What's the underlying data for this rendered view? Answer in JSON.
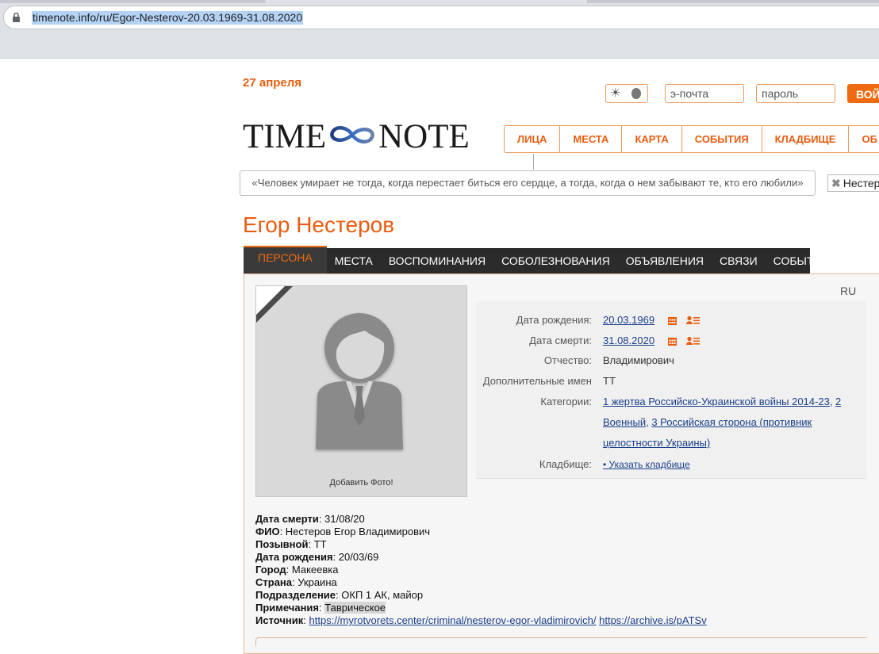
{
  "browser": {
    "url": "timenote.info/ru/Egor-Nesterov-20.03.1969-31.08.2020"
  },
  "header": {
    "date": "27 апреля",
    "email_placeholder": "э-почта",
    "password_placeholder": "пароль",
    "login_label": "ВОЙ",
    "logo_left": "TIME",
    "logo_right": "NOTE",
    "nav": [
      "ЛИЦА",
      "МЕСТА",
      "КАРТА",
      "СОБЫТИЯ",
      "КЛАДБИЩЕ",
      "ОБ"
    ],
    "quote": "«Человек умирает не тогда, когда перестает биться его сердце, а тогда, когда о нем забывают те, кто его любили»",
    "search_chip": "Нестер"
  },
  "person": {
    "name": "Егор Нестеров",
    "tabs": [
      "ПЕРСОНА",
      "МЕСТА",
      "ВОСПОМИНАНИЯ",
      "СОБОЛЕЗНОВАНИЯ",
      "ОБЪЯВЛЕНИЯ",
      "СВЯЗИ",
      "СОБЫТИЯ"
    ],
    "lang": "RU",
    "add_photo": "Добавить Фото!",
    "info": {
      "birth_label": "Дата рождения:",
      "birth_value": "20.03.1969",
      "death_label": "Дата смерти:",
      "death_value": "31.08.2020",
      "patronymic_label": "Отчество:",
      "patronymic_value": "Владимирович",
      "extra_names_label": "Дополнительные имен",
      "extra_names_value": "ТТ",
      "categories_label": "Категории:",
      "cat1": "1 жертва Российско-Украинской войны 2014-23",
      "cat2": "2",
      "cat2b": "Военный",
      "cat3": "3 Российская сторона (противник",
      "cat3b": "целостности Украины)",
      "cemetery_label": "Кладбище:",
      "cemetery_value": "• Указать кладбище"
    },
    "details": {
      "death_date_label": "Дата смерти",
      "death_date_value": ": 31/08/20",
      "fio_label": "ФИО",
      "fio_value": ": Нестеров Егор Владимирович",
      "callsign_label": "Позывной",
      "callsign_value": ": ТТ",
      "birth_date_label": "Дата рождения",
      "birth_date_value": ": 20/03/69",
      "city_label": "Город",
      "city_value": ": Макеевка",
      "country_label": "Страна",
      "country_value": ": Украина",
      "unit_label": "Подразделение",
      "unit_value": ": ОКП 1 АК, майор",
      "notes_label": "Примечания",
      "notes_sep": ": ",
      "notes_value": "Таврическое",
      "source_label": "Источник",
      "source_sep": ": ",
      "source_link1": "https://myrotvorets.center/criminal/nesterov-egor-vladimirovich/",
      "source_link2": "https://archive.is/pATSv"
    }
  },
  "colors": {
    "accent": "#e85d10",
    "tabbar": "#2b2b2b",
    "link": "#1a3f8b"
  }
}
